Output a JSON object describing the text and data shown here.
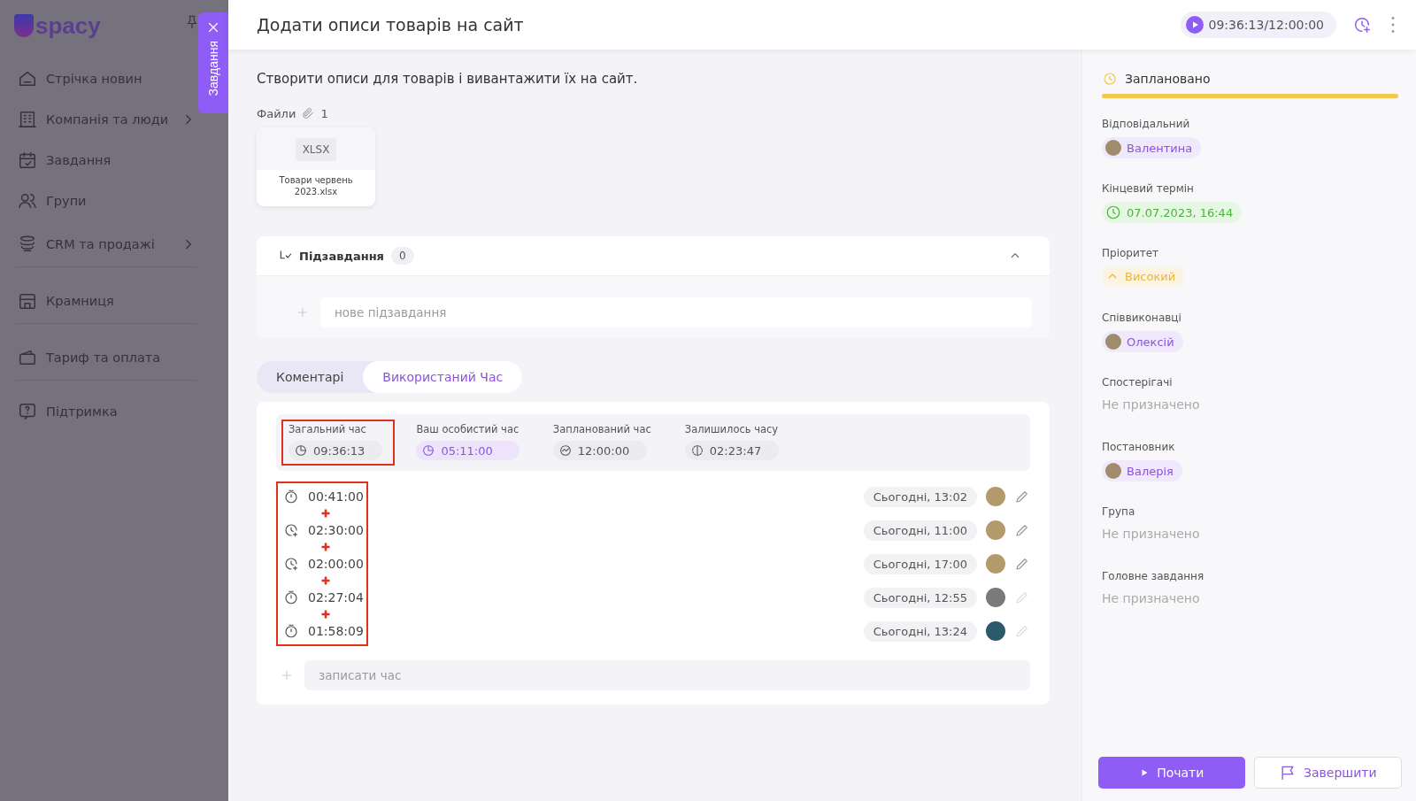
{
  "sidebar": {
    "logo_text": "spacy",
    "items": [
      {
        "label": "Стрічка новин",
        "has_submenu": false,
        "divider_after": false
      },
      {
        "label": "Компанія та люди",
        "has_submenu": true,
        "divider_after": false
      },
      {
        "label": "Завдання",
        "has_submenu": false,
        "divider_after": false
      },
      {
        "label": "Групи",
        "has_submenu": false,
        "divider_after": false
      },
      {
        "label": "CRM та продажі",
        "has_submenu": true,
        "divider_after": true
      },
      {
        "label": "Крамниця",
        "has_submenu": false,
        "divider_after": true
      },
      {
        "label": "Тариф та оплата",
        "has_submenu": false,
        "divider_after": true
      },
      {
        "label": "Підтримка",
        "has_submenu": false,
        "divider_after": false
      }
    ]
  },
  "side_tab": {
    "label": "Завдання"
  },
  "header": {
    "title": "Додати описи товарів на сайт",
    "timer": "09:36:13/12:00:00"
  },
  "description": "Створити описи для товарів і вивантажити їх на сайт.",
  "files": {
    "label": "Файли",
    "count": "1",
    "items": [
      {
        "type": "XLSX",
        "name": "Товари червень 2023.xlsx"
      }
    ]
  },
  "subtasks": {
    "title": "Підзавдання",
    "count": "0",
    "expanded": true,
    "placeholder": "нове підзавдання"
  },
  "tabs": [
    {
      "label": "Коментарі",
      "selected": false
    },
    {
      "label": "Використаний Час",
      "selected": true
    }
  ],
  "time_summary": [
    {
      "kind": "total",
      "label": "Загальний час",
      "value": "09:36:13",
      "annotated": true
    },
    {
      "kind": "personal",
      "label": "Ваш особистий час",
      "value": "05:11:00",
      "annotated": false
    },
    {
      "kind": "planned",
      "label": "Запланований час",
      "value": "12:00:00",
      "annotated": false
    },
    {
      "kind": "remaining",
      "label": "Залишилось часу",
      "value": "02:23:47",
      "annotated": false
    }
  ],
  "entries_annotated": true,
  "plus_marks": true,
  "time_entries": [
    {
      "kind": "timer",
      "duration": "00:41:00",
      "date": "Сьогодні, 13:02",
      "editable": true
    },
    {
      "kind": "manual",
      "duration": "02:30:00",
      "date": "Сьогодні, 11:00",
      "editable": true
    },
    {
      "kind": "manual",
      "duration": "02:00:00",
      "date": "Сьогодні, 17:00",
      "editable": true
    },
    {
      "kind": "timer",
      "duration": "02:27:04",
      "date": "Сьогодні, 12:55",
      "editable": false
    },
    {
      "kind": "timer",
      "duration": "01:58:09",
      "date": "Сьогодні, 13:24",
      "editable": false
    }
  ],
  "log_placeholder": "записати час",
  "status": {
    "label": "Заплановано",
    "color": "#f2c94c"
  },
  "fields": [
    {
      "label": "Відповідальний",
      "kind": "person",
      "value": "Валентина"
    },
    {
      "label": "Кінцевий термін",
      "kind": "date",
      "value": "07.07.2023, 16:44"
    },
    {
      "label": "Пріоритет",
      "kind": "priority",
      "value": "Високий"
    },
    {
      "label": "Співвиконавці",
      "kind": "person",
      "value": "Олексій"
    },
    {
      "label": "Спостерігачі",
      "kind": "empty",
      "value": "Не призначено"
    },
    {
      "label": "Постановник",
      "kind": "person",
      "value": "Валерія"
    },
    {
      "label": "Група",
      "kind": "empty",
      "value": "Не призначено"
    },
    {
      "label": "Головне завдання",
      "kind": "empty",
      "value": "Не призначено"
    }
  ],
  "buttons": {
    "start": "Почати",
    "finish": "Завершити"
  }
}
